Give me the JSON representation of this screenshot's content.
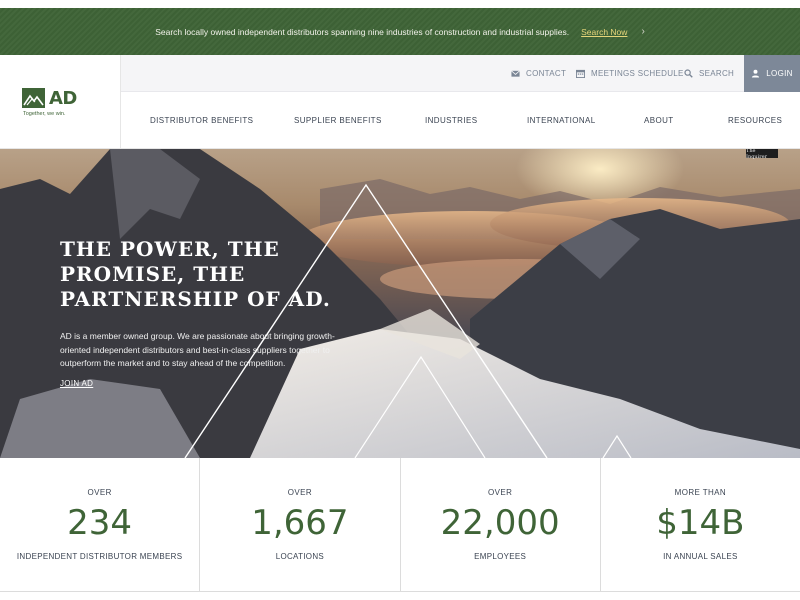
{
  "announcement": {
    "text": "Search locally owned independent distributors spanning nine industries of construction and industrial supplies.",
    "cta_label": "Search Now",
    "cta_chevron": "›"
  },
  "brand": {
    "logo_text": "AD",
    "tagline": "Together, we win.",
    "green": "#3f6437"
  },
  "utility_nav": {
    "contact": "CONTACT",
    "meetings": "MEETINGS SCHEDULE",
    "search": "SEARCH",
    "login": "LOGIN",
    "icons": [
      "envelope-icon",
      "calendar-icon",
      "search-icon",
      "user-icon"
    ]
  },
  "main_nav": [
    "DISTRIBUTOR BENEFITS",
    "SUPPLIER BENEFITS",
    "INDUSTRIES",
    "INTERNATIONAL",
    "ABOUT",
    "RESOURCES"
  ],
  "hero": {
    "badge": "The Inquirer",
    "title": "THE POWER, THE PROMISE, THE PARTNERSHIP OF AD.",
    "body": "AD is a member owned group. We are passionate about bringing growth-oriented independent distributors and best-in-class suppliers together to outperform the market and to stay ahead of the competition.",
    "link": "JOIN AD"
  },
  "stats": [
    {
      "top": "OVER",
      "value": "234",
      "bottom": "INDEPENDENT DISTRIBUTOR MEMBERS"
    },
    {
      "top": "OVER",
      "value": "1,667",
      "bottom": "LOCATIONS"
    },
    {
      "top": "OVER",
      "value": "22,000",
      "bottom": "EMPLOYEES"
    },
    {
      "top": "MORE THAN",
      "value": "$14B",
      "bottom": "IN ANNUAL SALES"
    }
  ]
}
